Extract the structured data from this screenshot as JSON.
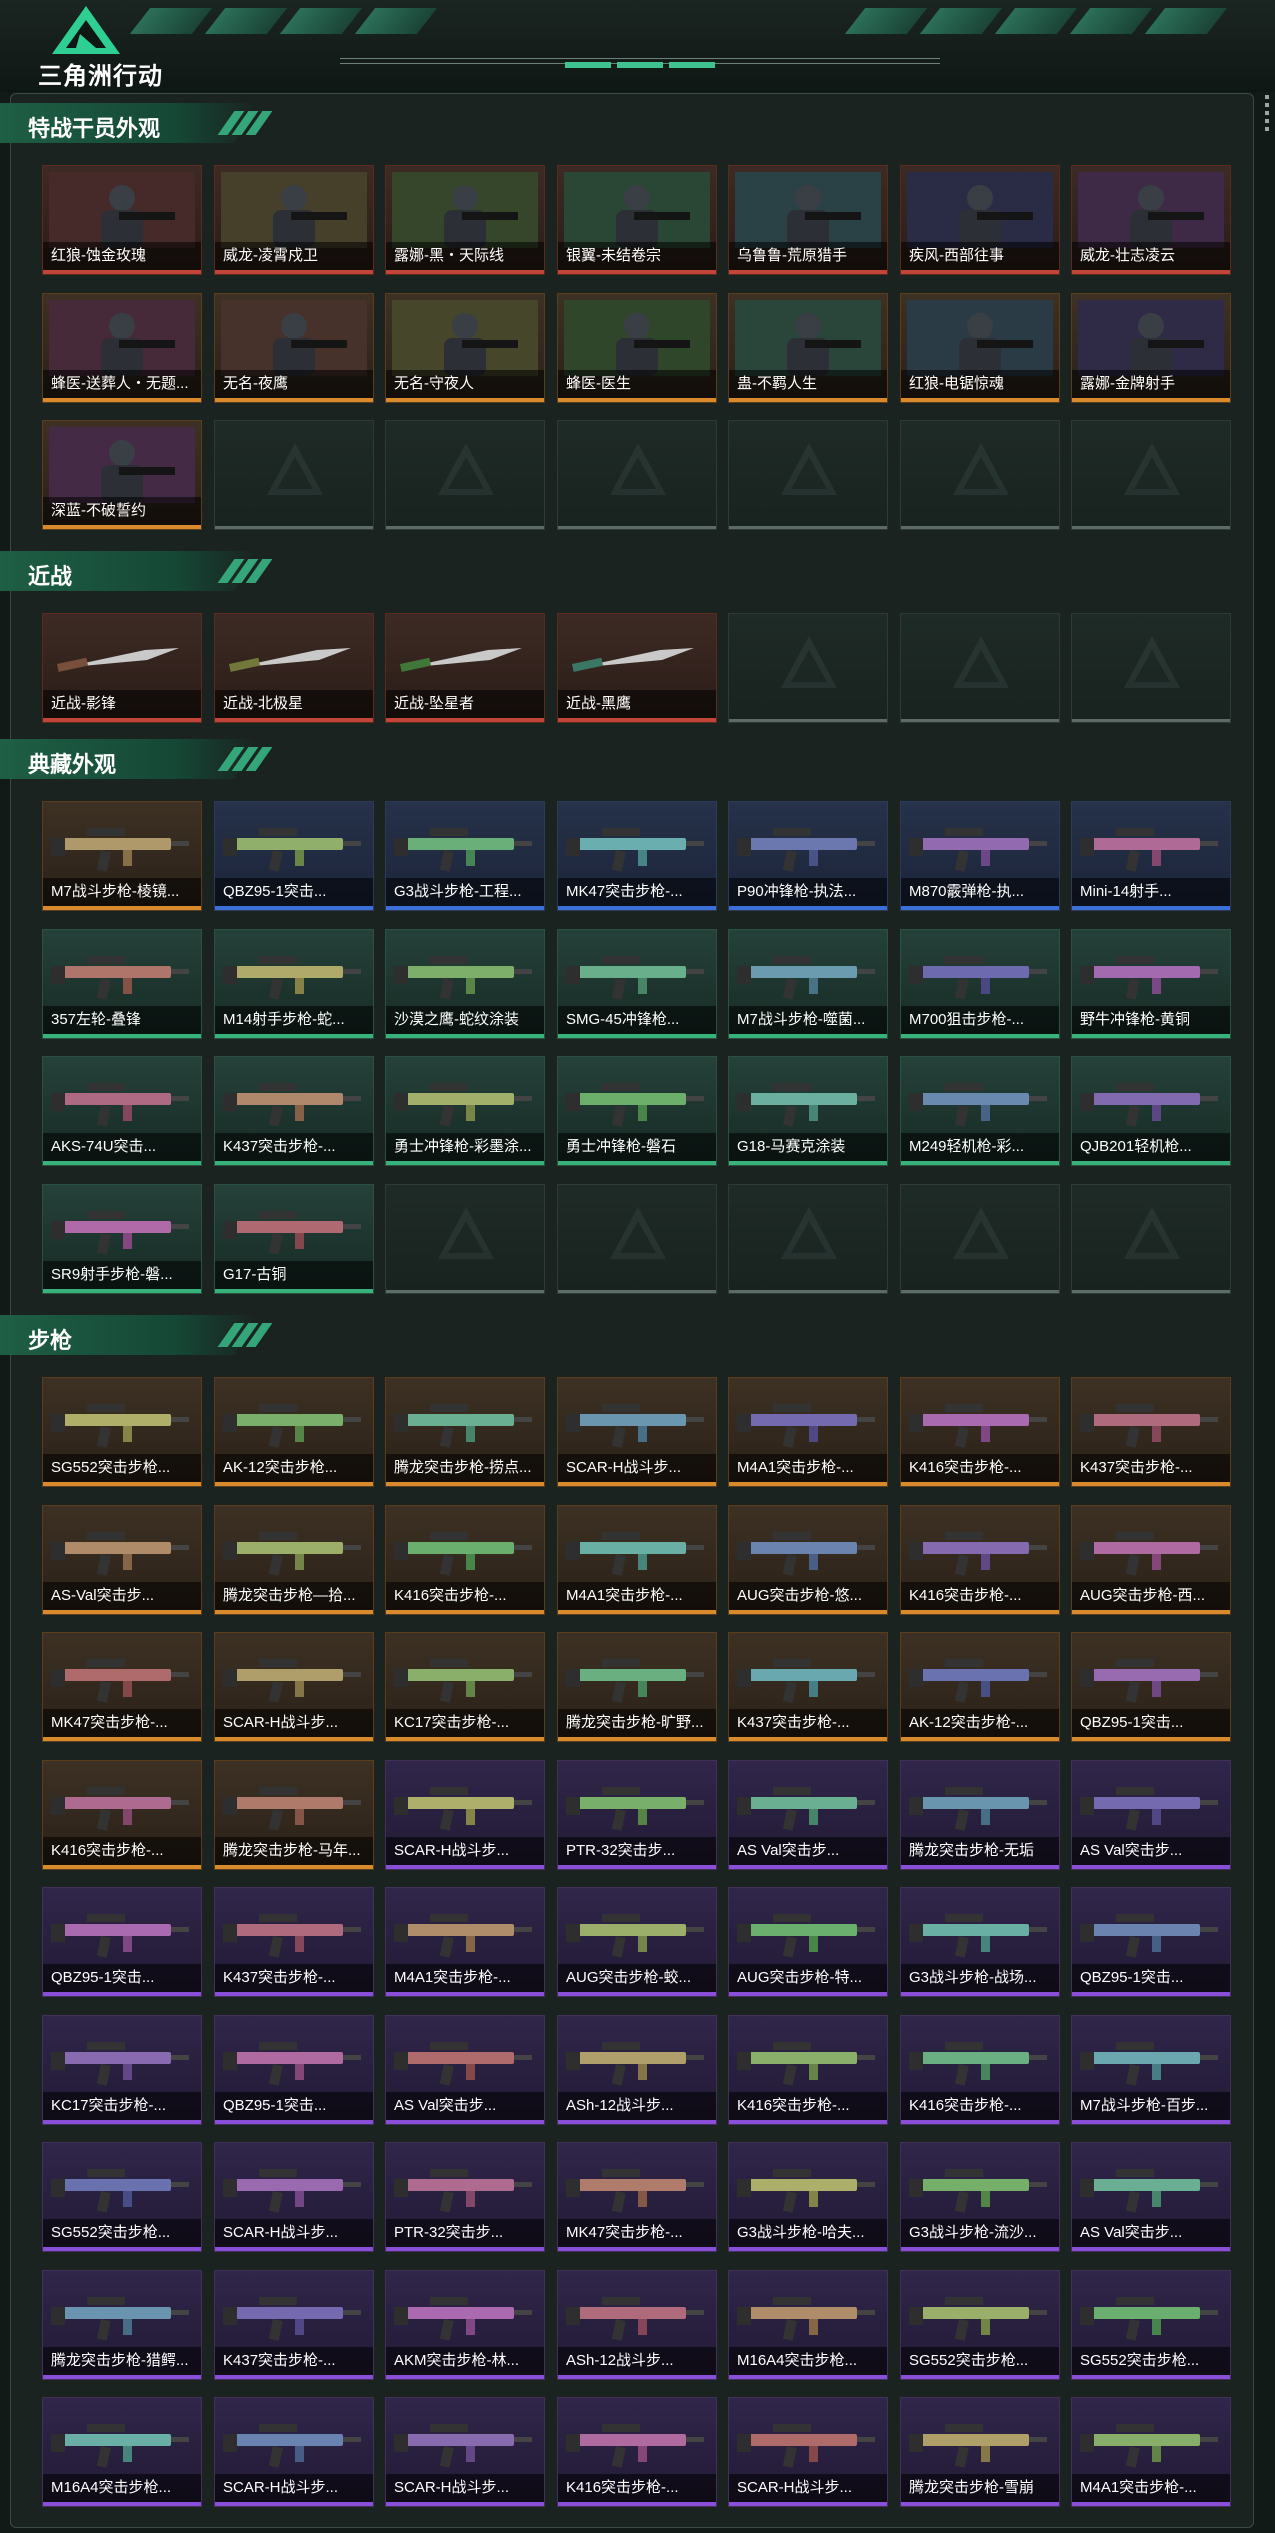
{
  "header": {
    "logo_text": "三角洲行动",
    "logo_icon": "delta-triangle-logo"
  },
  "colors": {
    "red": "#c2453a",
    "gold": "#d98a2c",
    "blue": "#3b6fd8",
    "purple": "#8a4fd8",
    "green": "#37b27a"
  },
  "sections": [
    {
      "title": "特战干员外观",
      "kind": "operator",
      "slots": 21,
      "items": [
        {
          "name": "红狼-蚀金玫瑰",
          "rarity": "red"
        },
        {
          "name": "威龙-凌霄戍卫",
          "rarity": "red"
        },
        {
          "name": "露娜-黑・天际线",
          "rarity": "red"
        },
        {
          "name": "银翼-未结卷宗",
          "rarity": "red"
        },
        {
          "name": "乌鲁鲁-荒原猎手",
          "rarity": "red"
        },
        {
          "name": "疾风-西部往事",
          "rarity": "red"
        },
        {
          "name": "威龙-壮志凌云",
          "rarity": "red"
        },
        {
          "name": "蜂医-送葬人・无题...",
          "rarity": "gold"
        },
        {
          "name": "无名-夜鹰",
          "rarity": "gold"
        },
        {
          "name": "无名-守夜人",
          "rarity": "gold"
        },
        {
          "name": "蜂医-医生",
          "rarity": "gold"
        },
        {
          "name": "蛊-不羁人生",
          "rarity": "gold"
        },
        {
          "name": "红狼-电锯惊魂",
          "rarity": "gold"
        },
        {
          "name": "露娜-金牌射手",
          "rarity": "gold"
        },
        {
          "name": "深蓝-不破誓约",
          "rarity": "gold"
        }
      ]
    },
    {
      "title": "近战",
      "kind": "knife",
      "slots": 7,
      "items": [
        {
          "name": "近战-影锋",
          "rarity": "red"
        },
        {
          "name": "近战-北极星",
          "rarity": "red"
        },
        {
          "name": "近战-坠星者",
          "rarity": "red"
        },
        {
          "name": "近战-黑鹰",
          "rarity": "red"
        }
      ]
    },
    {
      "title": "典藏外观",
      "kind": "gun",
      "slots": 28,
      "items": [
        {
          "name": "M7战斗步枪-棱镜...",
          "rarity": "gold"
        },
        {
          "name": "QBZ95-1突击...",
          "rarity": "blue"
        },
        {
          "name": "G3战斗步枪-工程...",
          "rarity": "blue"
        },
        {
          "name": "MK47突击步枪-...",
          "rarity": "blue"
        },
        {
          "name": "P90冲锋枪-执法...",
          "rarity": "blue"
        },
        {
          "name": "M870霰弹枪-执...",
          "rarity": "blue"
        },
        {
          "name": "Mini-14射手...",
          "rarity": "blue"
        },
        {
          "name": "357左轮-叠锋",
          "rarity": "green"
        },
        {
          "name": "M14射手步枪-蛇...",
          "rarity": "green"
        },
        {
          "name": "沙漠之鹰-蛇纹涂装",
          "rarity": "green"
        },
        {
          "name": "SMG-45冲锋枪...",
          "rarity": "green"
        },
        {
          "name": "M7战斗步枪-噬菌...",
          "rarity": "green"
        },
        {
          "name": "M700狙击步枪-...",
          "rarity": "green"
        },
        {
          "name": "野牛冲锋枪-黄铜",
          "rarity": "green"
        },
        {
          "name": "AKS-74U突击...",
          "rarity": "green"
        },
        {
          "name": "K437突击步枪-...",
          "rarity": "green"
        },
        {
          "name": "勇士冲锋枪-彩墨涂...",
          "rarity": "green"
        },
        {
          "name": "勇士冲锋枪-磐石",
          "rarity": "green"
        },
        {
          "name": "G18-马赛克涂装",
          "rarity": "green"
        },
        {
          "name": "M249轻机枪-彩...",
          "rarity": "green"
        },
        {
          "name": "QJB201轻机枪...",
          "rarity": "green"
        },
        {
          "name": "SR9射手步枪-磐...",
          "rarity": "green"
        },
        {
          "name": "G17-古铜",
          "rarity": "green"
        }
      ]
    },
    {
      "title": "步枪",
      "kind": "gun",
      "slots": 63,
      "items": [
        {
          "name": "SG552突击步枪...",
          "rarity": "gold"
        },
        {
          "name": "AK-12突击步枪...",
          "rarity": "gold"
        },
        {
          "name": "腾龙突击步枪-捞点...",
          "rarity": "gold"
        },
        {
          "name": "SCAR-H战斗步...",
          "rarity": "gold"
        },
        {
          "name": "M4A1突击步枪-...",
          "rarity": "gold"
        },
        {
          "name": "K416突击步枪-...",
          "rarity": "gold"
        },
        {
          "name": "K437突击步枪-...",
          "rarity": "gold"
        },
        {
          "name": "AS-Val突击步...",
          "rarity": "gold"
        },
        {
          "name": "腾龙突击步枪—拾...",
          "rarity": "gold"
        },
        {
          "name": "K416突击步枪-...",
          "rarity": "gold"
        },
        {
          "name": "M4A1突击步枪-...",
          "rarity": "gold"
        },
        {
          "name": "AUG突击步枪-悠...",
          "rarity": "gold"
        },
        {
          "name": "K416突击步枪-...",
          "rarity": "gold"
        },
        {
          "name": "AUG突击步枪-西...",
          "rarity": "gold"
        },
        {
          "name": "MK47突击步枪-...",
          "rarity": "gold"
        },
        {
          "name": "SCAR-H战斗步...",
          "rarity": "gold"
        },
        {
          "name": "KC17突击步枪-...",
          "rarity": "gold"
        },
        {
          "name": "腾龙突击步枪-旷野...",
          "rarity": "gold"
        },
        {
          "name": "K437突击步枪-...",
          "rarity": "gold"
        },
        {
          "name": "AK-12突击步枪-...",
          "rarity": "gold"
        },
        {
          "name": "QBZ95-1突击...",
          "rarity": "gold"
        },
        {
          "name": "K416突击步枪-...",
          "rarity": "gold"
        },
        {
          "name": "腾龙突击步枪-马年...",
          "rarity": "gold"
        },
        {
          "name": "SCAR-H战斗步...",
          "rarity": "purple"
        },
        {
          "name": "PTR-32突击步...",
          "rarity": "purple"
        },
        {
          "name": "AS Val突击步...",
          "rarity": "purple"
        },
        {
          "name": "腾龙突击步枪-无垢",
          "rarity": "purple"
        },
        {
          "name": "AS Val突击步...",
          "rarity": "purple"
        },
        {
          "name": "QBZ95-1突击...",
          "rarity": "purple"
        },
        {
          "name": "K437突击步枪-...",
          "rarity": "purple"
        },
        {
          "name": "M4A1突击步枪-...",
          "rarity": "purple"
        },
        {
          "name": "AUG突击步枪-蛟...",
          "rarity": "purple"
        },
        {
          "name": "AUG突击步枪-特...",
          "rarity": "purple"
        },
        {
          "name": "G3战斗步枪-战场...",
          "rarity": "purple"
        },
        {
          "name": "QBZ95-1突击...",
          "rarity": "purple"
        },
        {
          "name": "KC17突击步枪-...",
          "rarity": "purple"
        },
        {
          "name": "QBZ95-1突击...",
          "rarity": "purple"
        },
        {
          "name": "AS Val突击步...",
          "rarity": "purple"
        },
        {
          "name": "ASh-12战斗步...",
          "rarity": "purple"
        },
        {
          "name": "K416突击步枪-...",
          "rarity": "purple"
        },
        {
          "name": "K416突击步枪-...",
          "rarity": "purple"
        },
        {
          "name": "M7战斗步枪-百步...",
          "rarity": "purple"
        },
        {
          "name": "SG552突击步枪...",
          "rarity": "purple"
        },
        {
          "name": "SCAR-H战斗步...",
          "rarity": "purple"
        },
        {
          "name": "PTR-32突击步...",
          "rarity": "purple"
        },
        {
          "name": "MK47突击步枪-...",
          "rarity": "purple"
        },
        {
          "name": "G3战斗步枪-哈夫...",
          "rarity": "purple"
        },
        {
          "name": "G3战斗步枪-流沙...",
          "rarity": "purple"
        },
        {
          "name": "AS Val突击步...",
          "rarity": "purple"
        },
        {
          "name": "腾龙突击步枪-猎鳄...",
          "rarity": "purple"
        },
        {
          "name": "K437突击步枪-...",
          "rarity": "purple"
        },
        {
          "name": "AKM突击步枪-林...",
          "rarity": "purple"
        },
        {
          "name": "ASh-12战斗步...",
          "rarity": "purple"
        },
        {
          "name": "M16A4突击步枪...",
          "rarity": "purple"
        },
        {
          "name": "SG552突击步枪...",
          "rarity": "purple"
        },
        {
          "name": "SG552突击步枪...",
          "rarity": "purple"
        },
        {
          "name": "M16A4突击步枪...",
          "rarity": "purple"
        },
        {
          "name": "SCAR-H战斗步...",
          "rarity": "purple"
        },
        {
          "name": "SCAR-H战斗步...",
          "rarity": "purple"
        },
        {
          "name": "K416突击步枪-...",
          "rarity": "purple"
        },
        {
          "name": "SCAR-H战斗步...",
          "rarity": "purple"
        },
        {
          "name": "腾龙突击步枪-雪崩",
          "rarity": "purple"
        },
        {
          "name": "M4A1突击步枪-...",
          "rarity": "purple"
        }
      ]
    }
  ]
}
